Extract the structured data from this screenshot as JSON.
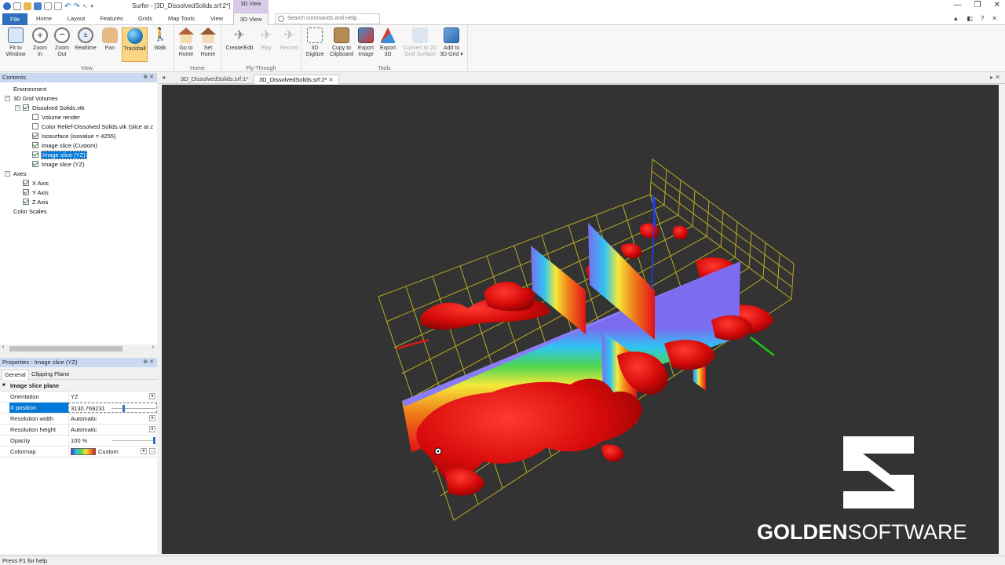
{
  "window": {
    "title": "Surfer - [3D_DissolvedSolids.srf:2*]",
    "contextual_tab_group": "3D View"
  },
  "tabs": [
    "File",
    "Home",
    "Layout",
    "Features",
    "Grids",
    "Map Tools",
    "View",
    "3D View"
  ],
  "active_tab": "3D View",
  "search_placeholder": "Search commands and Help...",
  "ribbon": {
    "groups": [
      {
        "label": "View",
        "buttons": [
          {
            "label": "Fit to Window",
            "l1": "Fit to",
            "l2": "Window",
            "icon": "fit-to-window-icon"
          },
          {
            "label": "Zoom In",
            "l1": "Zoom",
            "l2": "In",
            "icon": "zoom-in-icon"
          },
          {
            "label": "Zoom Out",
            "l1": "Zoom",
            "l2": "Out",
            "icon": "zoom-out-icon"
          },
          {
            "label": "Realtime",
            "l1": "Realtime",
            "l2": "",
            "icon": "zoom-realtime-icon"
          },
          {
            "label": "Pan",
            "l1": "Pan",
            "l2": "",
            "icon": "hand-icon"
          },
          {
            "label": "Trackball",
            "l1": "Trackball",
            "l2": "",
            "icon": "globe-icon",
            "selected": true
          },
          {
            "label": "Walk",
            "l1": "Walk",
            "l2": "",
            "icon": "walk-icon"
          }
        ]
      },
      {
        "label": "Home",
        "buttons": [
          {
            "label": "Go to Home",
            "l1": "Go to",
            "l2": "Home",
            "icon": "home-icon"
          },
          {
            "label": "Set Home",
            "l1": "Set",
            "l2": "Home",
            "icon": "set-home-icon"
          }
        ]
      },
      {
        "label": "Fly-Through",
        "buttons": [
          {
            "label": "Create/Edit",
            "l1": "Create/Edit",
            "l2": "",
            "icon": "airplane-icon"
          },
          {
            "label": "Play",
            "l1": "Play",
            "l2": "",
            "icon": "airplane-play-icon",
            "disabled": true
          },
          {
            "label": "Record",
            "l1": "Record",
            "l2": "",
            "icon": "airplane-record-icon",
            "disabled": true
          }
        ]
      },
      {
        "label": "Tools",
        "buttons": [
          {
            "label": "3D Digitize",
            "l1": "3D",
            "l2": "Digitize",
            "icon": "digitize-icon"
          },
          {
            "label": "Copy to Clipboard",
            "l1": "Copy to",
            "l2": "Clipboard",
            "icon": "clipboard-icon"
          },
          {
            "label": "Export Image",
            "l1": "Export",
            "l2": "Image",
            "icon": "export-image-icon"
          },
          {
            "label": "Export 3D",
            "l1": "Export",
            "l2": "3D",
            "icon": "export-3d-icon"
          },
          {
            "label": "Convert to 2D Grid Surface",
            "l1": "Convert to 2D",
            "l2": "Grid Surface",
            "icon": "convert-grid-icon",
            "disabled": true
          },
          {
            "label": "Add to 3D Grid",
            "l1": "Add to",
            "l2": "3D Grid ▾",
            "icon": "add-3d-grid-icon"
          }
        ]
      }
    ]
  },
  "contents_panel": {
    "title": "Contents",
    "items": [
      {
        "label": "Environment",
        "indent": 0,
        "checkbox": false
      },
      {
        "label": "3D Grid Volumes",
        "indent": 0,
        "checkbox": false,
        "expander": "-"
      },
      {
        "label": "Dissolved Solids.vtk",
        "indent": 1,
        "checkbox": true,
        "checked": true,
        "expander": "-"
      },
      {
        "label": "Volume render",
        "indent": 2,
        "checkbox": true,
        "checked": false
      },
      {
        "label": "Color Relief-Dissolved Solids.vtk (slice at z",
        "indent": 2,
        "checkbox": true,
        "checked": false
      },
      {
        "label": "Isosurface (isovalue = 4255)",
        "indent": 2,
        "checkbox": true,
        "checked": true
      },
      {
        "label": "Image slice (Custom)",
        "indent": 2,
        "checkbox": true,
        "checked": true
      },
      {
        "label": "Image slice (YZ)",
        "indent": 2,
        "checkbox": true,
        "checked": true,
        "selected": true
      },
      {
        "label": "Image slice (YZ)",
        "indent": 2,
        "checkbox": true,
        "checked": true
      },
      {
        "label": "Axes",
        "indent": 0,
        "checkbox": false,
        "expander": "-"
      },
      {
        "label": "X Axis",
        "indent": 1,
        "checkbox": true,
        "checked": true
      },
      {
        "label": "Y Axis",
        "indent": 1,
        "checkbox": true,
        "checked": true
      },
      {
        "label": "Z Axis",
        "indent": 1,
        "checkbox": true,
        "checked": true
      },
      {
        "label": "Color Scales",
        "indent": 0,
        "checkbox": false
      }
    ]
  },
  "properties_panel": {
    "title": "Properties - Image slice (YZ)",
    "tabs": [
      "General",
      "Clipping Plane"
    ],
    "section": "Image slice plane",
    "rows": [
      {
        "key": "Orientation",
        "value": "YZ",
        "dropdown": true
      },
      {
        "key": "X position",
        "value": "3130.769231",
        "slider": true,
        "selected": true
      },
      {
        "key": "Resolution width",
        "value": "Automatic",
        "dropdown": true
      },
      {
        "key": "Resolution height",
        "value": "Automatic",
        "dropdown": true
      },
      {
        "key": "Opacity",
        "value": "100 %",
        "slider": true
      },
      {
        "key": "Colormap",
        "value": "Custom",
        "dropdown": true,
        "colormap": true
      }
    ]
  },
  "document_tabs": [
    "3D_DissolvedSolids.srf:1*",
    "3D_DissolvedSolids.srf:2*"
  ],
  "active_document": "3D_DissolvedSolids.srf:2*",
  "status_text": "Press F1 for help",
  "logo": {
    "bold": "GOLDEN",
    "light": "SOFTWARE"
  },
  "colors": {
    "file_tab": "#2f6fc0",
    "contextual": "#d8cbe8",
    "view_background": "#333333",
    "isosurface": "#e00a0a",
    "slice_low": "#7b6cf0",
    "grid": "#d4c21c",
    "selection": "#0078d7"
  }
}
